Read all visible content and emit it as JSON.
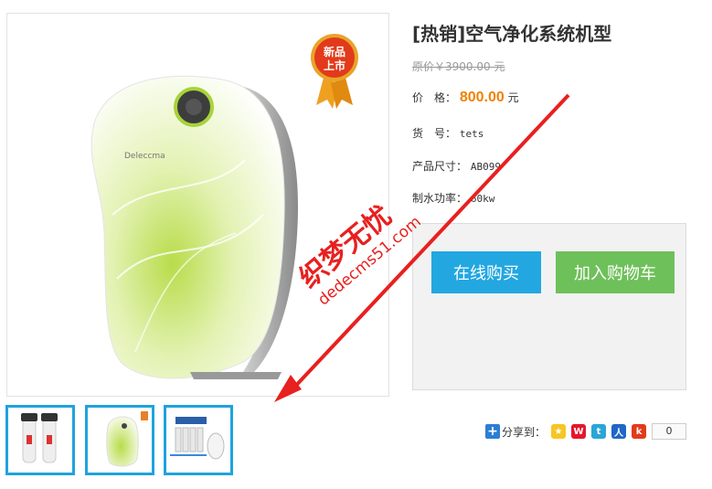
{
  "product": {
    "title": "[热销]空气净化系统机型",
    "original_price": "原价￥3900.00 元",
    "price_label": "价　格：",
    "price_value": "800.00",
    "price_unit": "元",
    "sku_label": "货　号：",
    "sku_value": "tets",
    "size_label": "产品尺寸：",
    "size_value": "AB099",
    "power_label": "制水功率：",
    "power_value": "60kw"
  },
  "badge": {
    "line1": "新品",
    "line2": "上市"
  },
  "device_brand": "Deleccma",
  "actions": {
    "buy_now": "在线购买",
    "add_to_cart": "加入购物车"
  },
  "thumbnails": [
    {
      "name": "water-filter-twin"
    },
    {
      "name": "air-purifier-green"
    },
    {
      "name": "ro-system"
    }
  ],
  "share": {
    "label": "分享到：",
    "count": "0",
    "icons": [
      "qzone-icon",
      "weibo-icon",
      "tencent-weibo-icon",
      "renren-icon",
      "kaixin-icon"
    ]
  },
  "watermark": {
    "text_cn": "织梦无忧",
    "text_url": "dedecms51.com"
  },
  "colors": {
    "accent_blue": "#22a7e1",
    "accent_green": "#6ec05a",
    "price_orange": "#f08200",
    "arrow_red": "#e8201f"
  }
}
